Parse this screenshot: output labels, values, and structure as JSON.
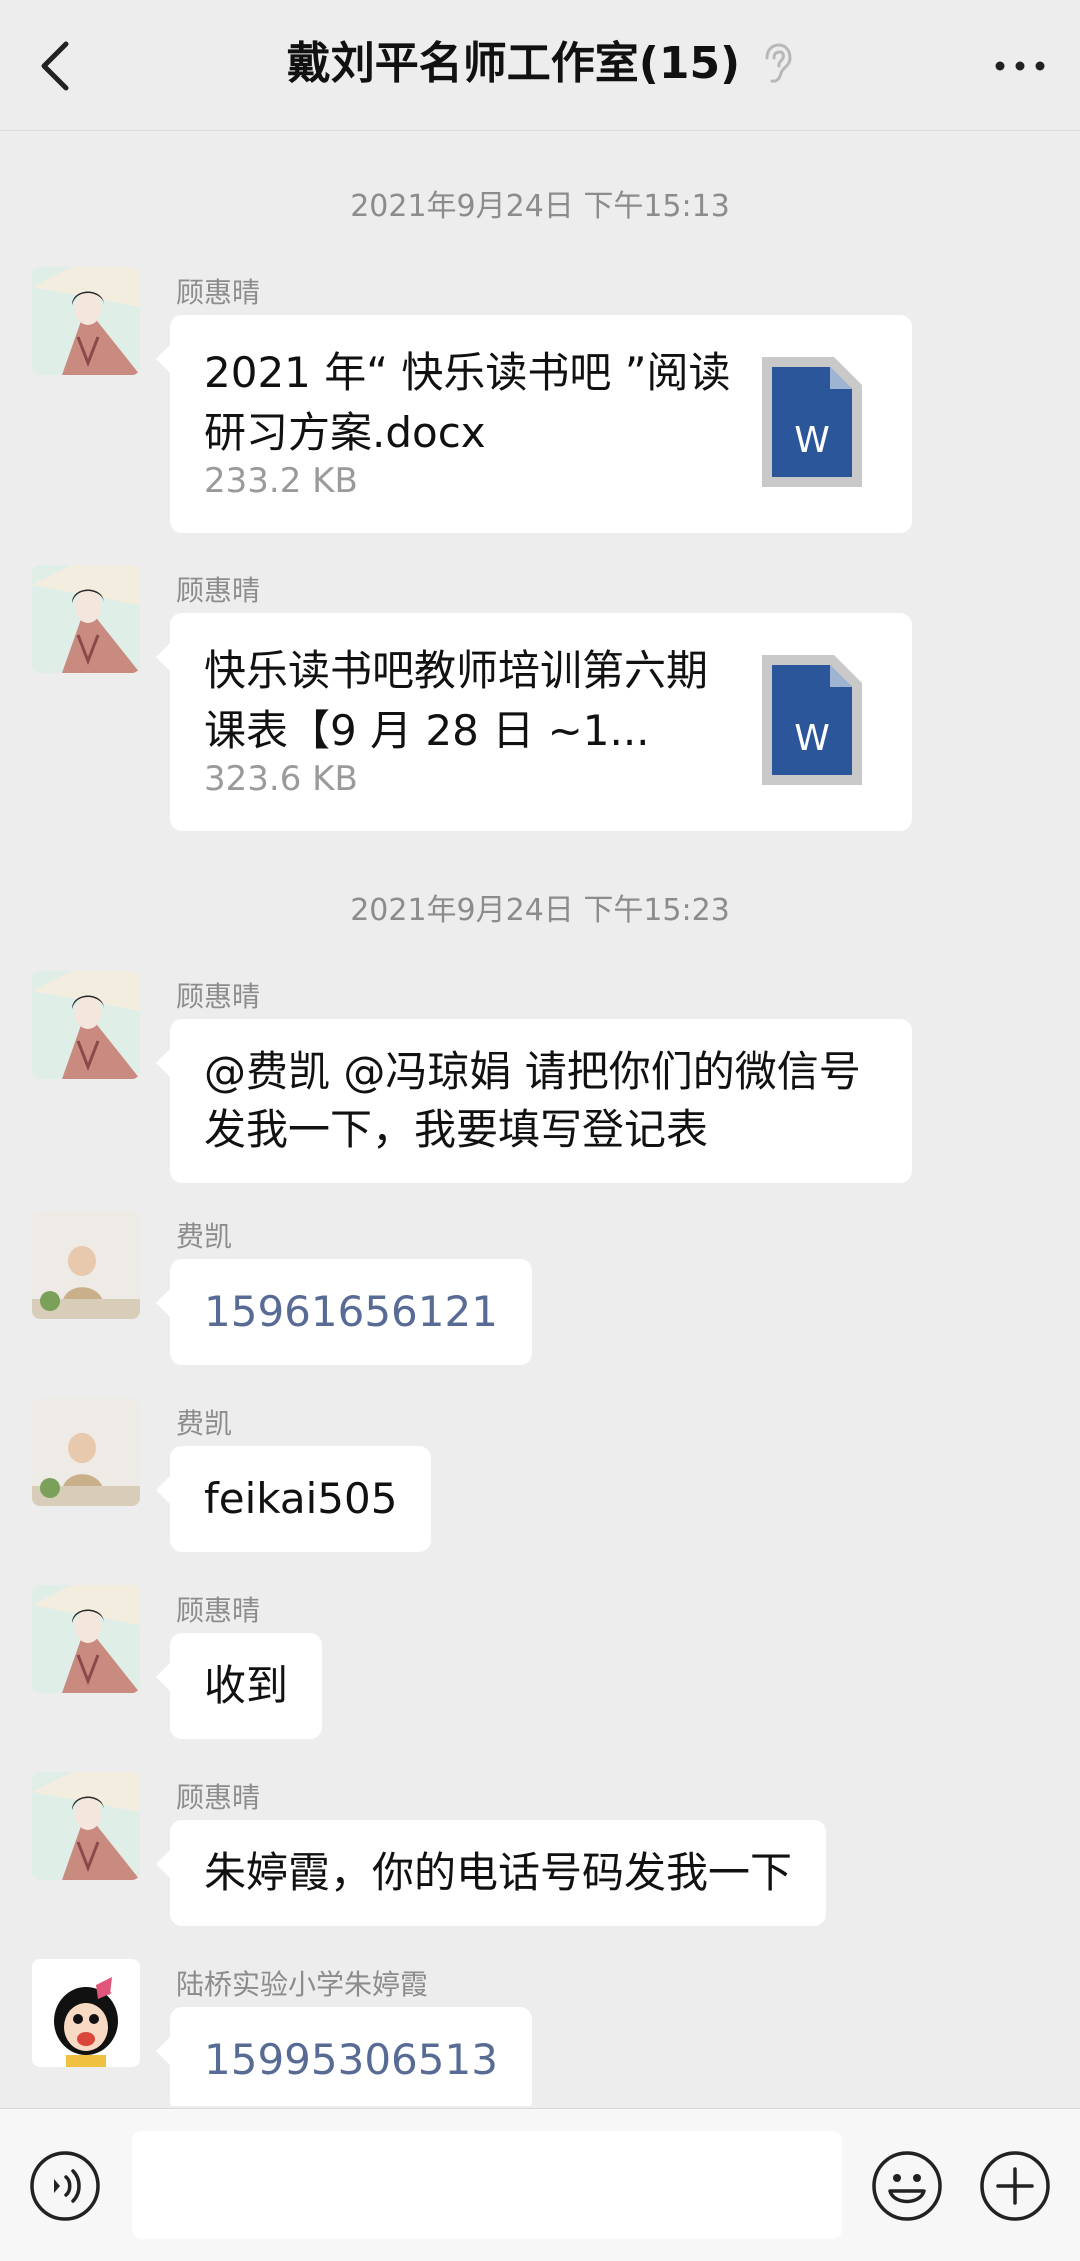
{
  "header": {
    "title": "戴刘平名师工作室(15)",
    "back_icon": "chevron-left-icon",
    "mute_icon": "ear-icon",
    "more_icon": "more-dots-icon"
  },
  "chat": {
    "timestamps": [
      "2021年9月24日 下午15:13",
      "2021年9月24日 下午15:23"
    ],
    "messages": [
      {
        "sender": "顾惠晴",
        "type": "file",
        "file_name": "2021 年“ 快乐读书吧 ”阅读研习方案.docx",
        "file_size": "233.2 KB",
        "file_icon": "word-document-icon"
      },
      {
        "sender": "顾惠晴",
        "type": "file",
        "file_name": "快乐读书吧教师培训第六期课表【9 月 28 日 ~1...",
        "file_size": "323.6 KB",
        "file_icon": "word-document-icon"
      },
      {
        "sender": "顾惠晴",
        "type": "text",
        "text": "@费凯 @冯琼娟  请把你们的微信号发我一下，我要填写登记表"
      },
      {
        "sender": "费凯",
        "type": "link",
        "text": "15961656121"
      },
      {
        "sender": "费凯",
        "type": "text",
        "text": "feikai505"
      },
      {
        "sender": "顾惠晴",
        "type": "text",
        "text": "收到"
      },
      {
        "sender": "顾惠晴",
        "type": "text",
        "text": "朱婷霞，你的电话号码发我一下"
      },
      {
        "sender": "陆桥实验小学朱婷霞",
        "type": "link",
        "text": "15995306513"
      }
    ]
  },
  "input_bar": {
    "voice_icon": "voice-icon",
    "emoji_icon": "emoji-icon",
    "plus_icon": "plus-icon",
    "input_value": ""
  },
  "colors": {
    "background": "#ededed",
    "bubble": "#ffffff",
    "link": "#576b95",
    "word_blue": "#2b579a"
  }
}
